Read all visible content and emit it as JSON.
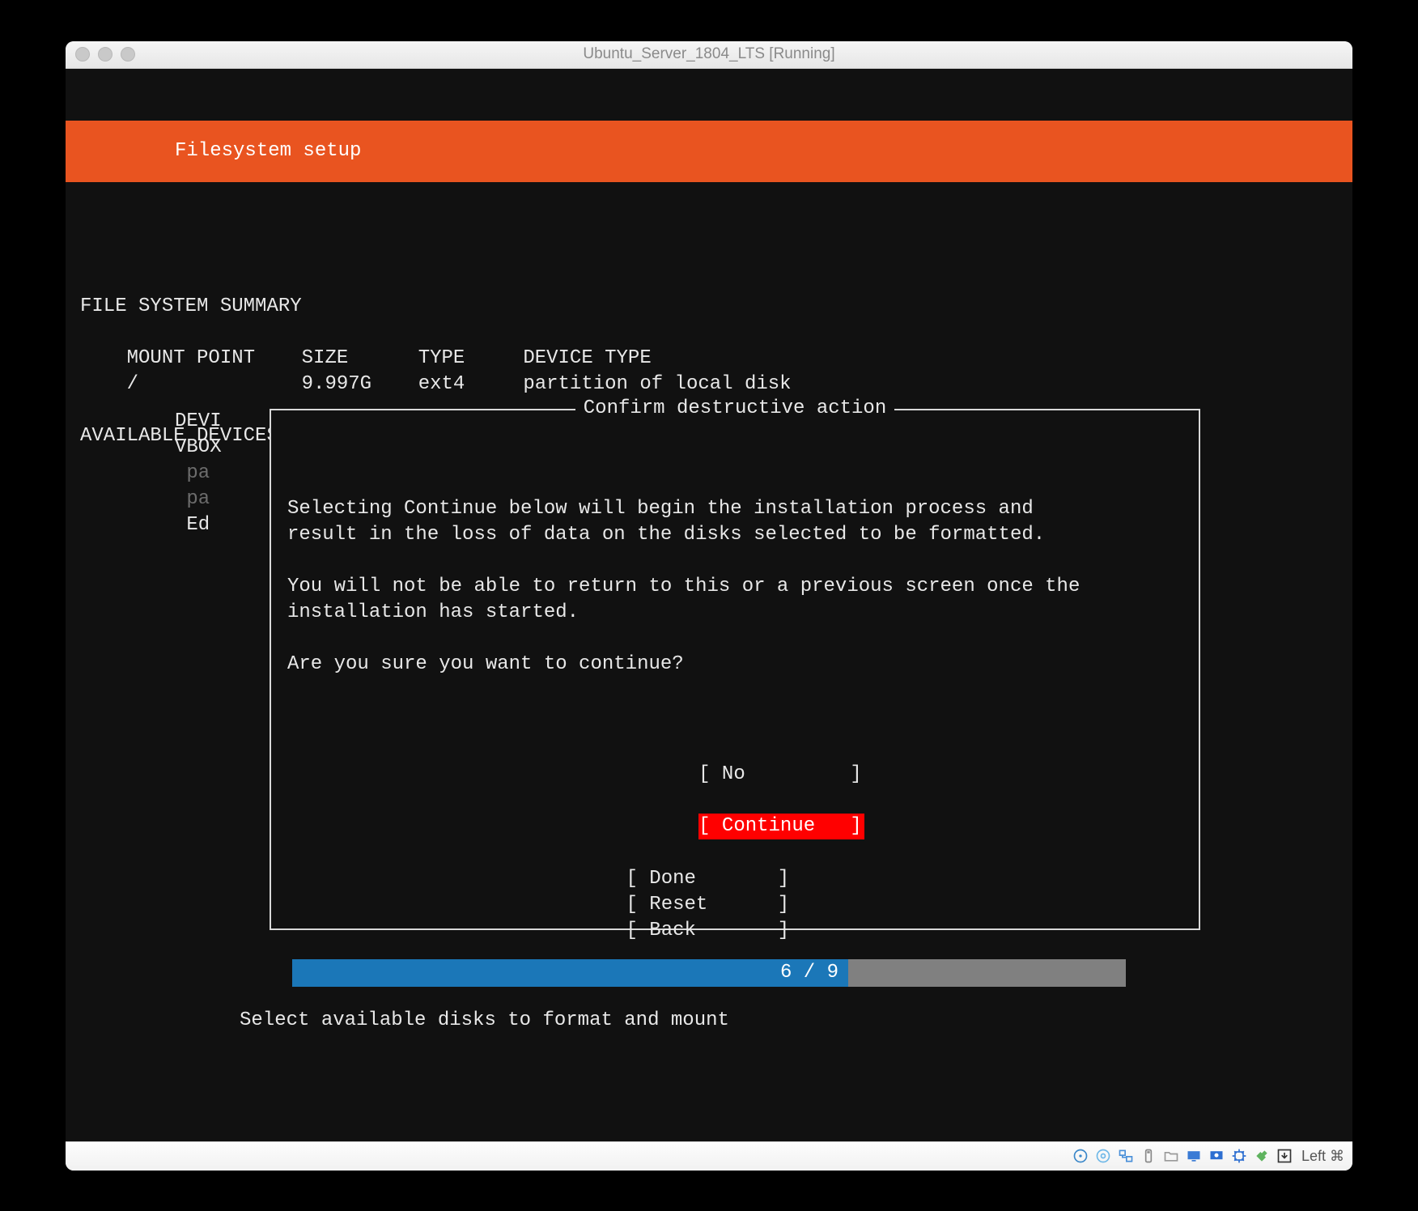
{
  "window": {
    "title": "Ubuntu_Server_1804_LTS [Running]"
  },
  "header": {
    "title": "Filesystem setup"
  },
  "summary": {
    "heading": "FILE SYSTEM SUMMARY",
    "cols": {
      "c1": "MOUNT POINT",
      "c2": "SIZE",
      "c3": "TYPE",
      "c4": "DEVICE TYPE"
    },
    "row": {
      "c1": "/",
      "c2": "9.997G",
      "c3": "ext4",
      "c4": "partition of local disk"
    }
  },
  "devices": {
    "heading": "AVAILABLE DEVICES",
    "col": {
      "l1": "DEVI",
      "l2": "VBOX",
      "l3": "pa",
      "l4": "pa",
      "l5": "Ed"
    }
  },
  "dialog": {
    "title": "Confirm destructive action",
    "p1": "Selecting Continue below will begin the installation process and",
    "p2": "result in the loss of data on the disks selected to be formatted.",
    "p3": "You will not be able to return to this or a previous screen once the",
    "p4": "installation has started.",
    "p5": "Are you sure you want to continue?",
    "no": "[ No         ]",
    "cont": "[ Continue   ]"
  },
  "bottom": {
    "done": "[ Done       ]",
    "reset": "[ Reset      ]",
    "back": "[ Back       ]"
  },
  "progress": {
    "label": "6 / 9",
    "current": 6,
    "total": 9
  },
  "hint": "Select available disks to format and mount",
  "statusbar": {
    "host_key": "Left ⌘"
  }
}
